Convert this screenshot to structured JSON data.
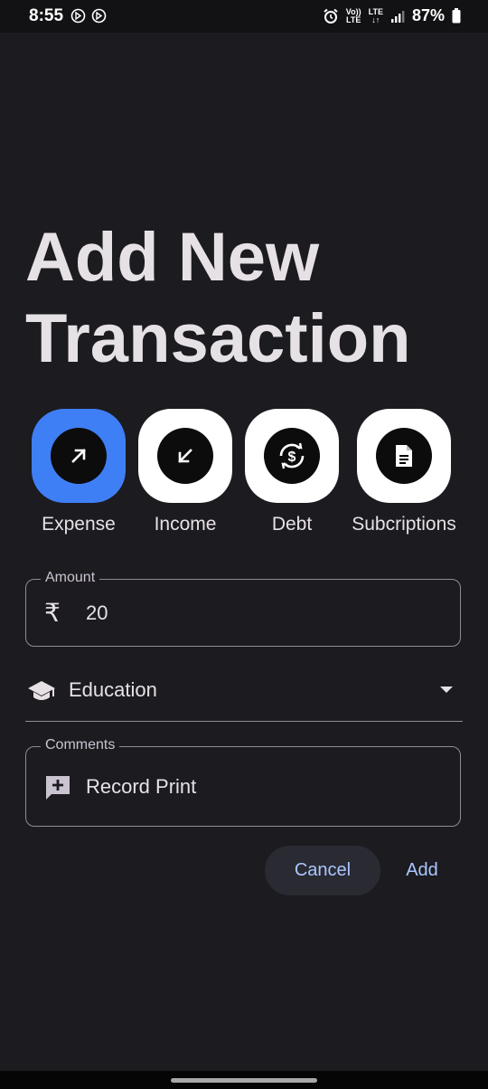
{
  "status_bar": {
    "time": "8:55",
    "volte_top": "Vo))",
    "volte_bottom": "LTE",
    "lte_top": "LTE",
    "lte_bottom": "↓↑",
    "battery_percent": "87%"
  },
  "page": {
    "title": "Add New Transaction"
  },
  "transaction_types": [
    {
      "label": "Expense",
      "icon": "arrow-up-right-icon",
      "selected": true
    },
    {
      "label": "Income",
      "icon": "arrow-down-left-icon",
      "selected": false
    },
    {
      "label": "Debt",
      "icon": "dollar-sync-icon",
      "selected": false
    },
    {
      "label": "Subcriptions",
      "icon": "document-icon",
      "selected": false
    }
  ],
  "amount": {
    "label": "Amount",
    "currency_symbol": "₹",
    "value": "20"
  },
  "category": {
    "icon": "graduation-cap-icon",
    "value": "Education"
  },
  "comments": {
    "label": "Comments",
    "icon": "add-comment-icon",
    "value": "Record Print"
  },
  "actions": {
    "cancel_label": "Cancel",
    "add_label": "Add"
  },
  "colors": {
    "background": "#1c1b20",
    "accent_selected": "#3f7ff6",
    "button_text": "#aac7ff"
  }
}
